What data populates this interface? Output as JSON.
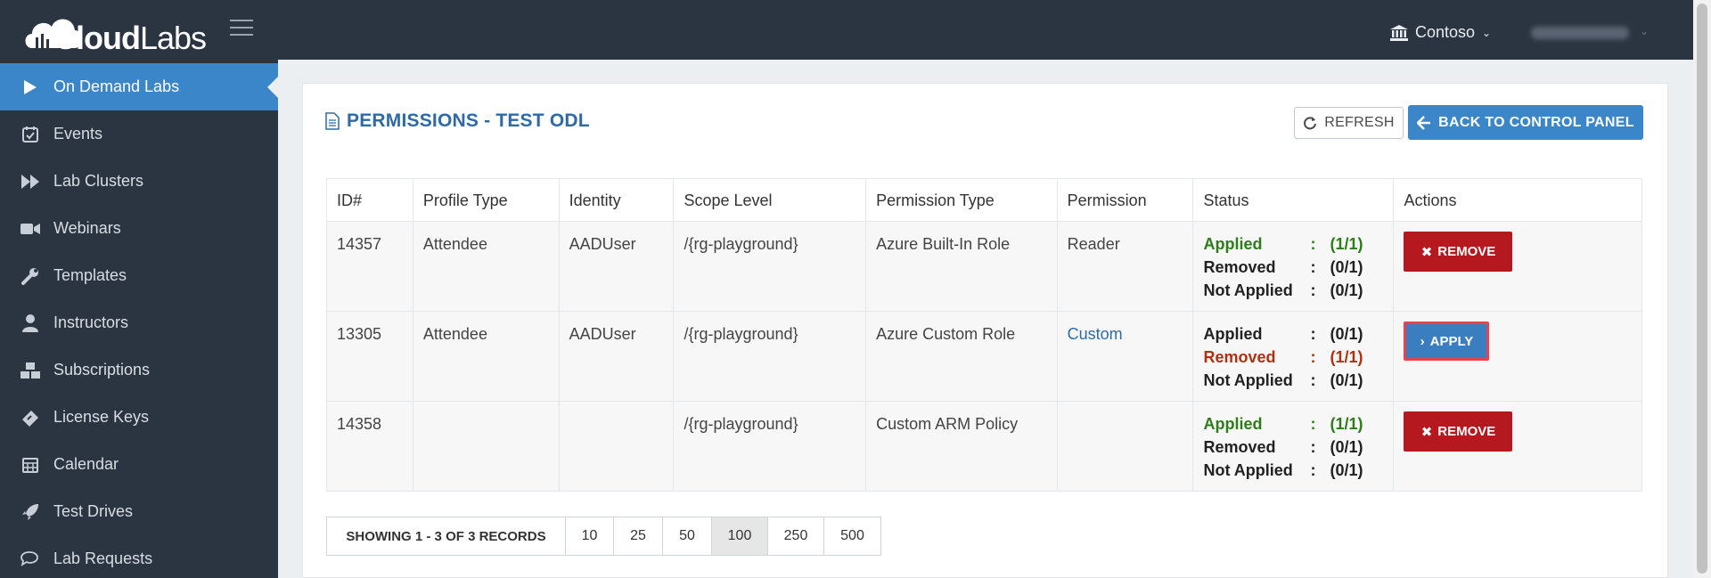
{
  "header": {
    "logo_text_bold": "Cloud",
    "logo_text_light": "Labs",
    "tenant": "Contoso"
  },
  "sidebar": {
    "items": [
      {
        "label": "On Demand Labs",
        "icon": "play-icon",
        "active": true
      },
      {
        "label": "Events",
        "icon": "calendar-check-icon"
      },
      {
        "label": "Lab Clusters",
        "icon": "fast-forward-icon"
      },
      {
        "label": "Webinars",
        "icon": "video-camera-icon"
      },
      {
        "label": "Templates",
        "icon": "wrench-icon"
      },
      {
        "label": "Instructors",
        "icon": "user-icon"
      },
      {
        "label": "Subscriptions",
        "icon": "cubes-icon"
      },
      {
        "label": "License Keys",
        "icon": "ticket-icon"
      },
      {
        "label": "Calendar",
        "icon": "calendar-icon"
      },
      {
        "label": "Test Drives",
        "icon": "rocket-icon"
      },
      {
        "label": "Lab Requests",
        "icon": "comments-icon"
      }
    ]
  },
  "main": {
    "title": "PERMISSIONS - TEST ODL",
    "refresh_label": "REFRESH",
    "back_label": "BACK TO CONTROL PANEL",
    "table": {
      "headers": [
        "ID#",
        "Profile Type",
        "Identity",
        "Scope Level",
        "Permission Type",
        "Permission",
        "Status",
        "Actions"
      ],
      "status_labels": {
        "applied": "Applied",
        "removed": "Removed",
        "not_applied": "Not Applied",
        "sep": ":"
      },
      "rows": [
        {
          "id": "14357",
          "profile": "Attendee",
          "identity": "AADUser",
          "scope": "/{rg-playground}",
          "ptype": "Azure Built-In Role",
          "permission": "Reader",
          "applied": "(1/1)",
          "removed": "(0/1)",
          "not_applied": "(0/1)",
          "action": "REMOVE"
        },
        {
          "id": "13305",
          "profile": "Attendee",
          "identity": "AADUser",
          "scope": "/{rg-playground}",
          "ptype": "Azure Custom Role",
          "permission": "Custom",
          "applied": "(0/1)",
          "removed": "(1/1)",
          "not_applied": "(0/1)",
          "action": "APPLY"
        },
        {
          "id": "14358",
          "profile": "",
          "identity": "",
          "scope": "/{rg-playground}",
          "ptype": "Custom ARM Policy",
          "permission": "",
          "applied": "(1/1)",
          "removed": "(0/1)",
          "not_applied": "(0/1)",
          "action": "REMOVE"
        }
      ]
    },
    "pager": {
      "info": "SHOWING 1 - 3 OF 3 RECORDS",
      "sizes": [
        "10",
        "25",
        "50",
        "100",
        "250",
        "500"
      ],
      "selected": "100"
    }
  },
  "colors": {
    "accent": "#3a86c8",
    "danger": "#b5191f",
    "success": "#2e7d1a",
    "removed": "#b03012",
    "sidebar": "#2b3542"
  }
}
